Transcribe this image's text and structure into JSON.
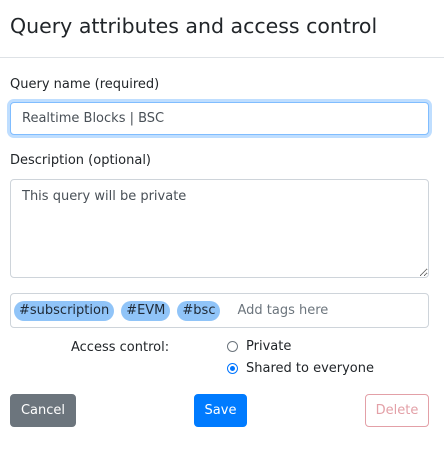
{
  "modal": {
    "title": "Query attributes and access control"
  },
  "form": {
    "name_label": "Query name (required)",
    "name_value": "Realtime Blocks | BSC",
    "description_label": "Description (optional)",
    "description_value": "This query will be private",
    "tags": [
      "#subscription",
      "#EVM",
      "#bsc"
    ],
    "tags_placeholder": "Add tags here",
    "access_label": "Access control:",
    "access_options": [
      {
        "label": "Private",
        "selected": false
      },
      {
        "label": "Shared to everyone",
        "selected": true
      }
    ]
  },
  "buttons": {
    "cancel": "Cancel",
    "save": "Save",
    "delete": "Delete"
  },
  "colors": {
    "primary": "#007bff",
    "secondary": "#6c757d",
    "danger_outline": "#e3a0a7",
    "tag_bg": "#90c4f8"
  }
}
